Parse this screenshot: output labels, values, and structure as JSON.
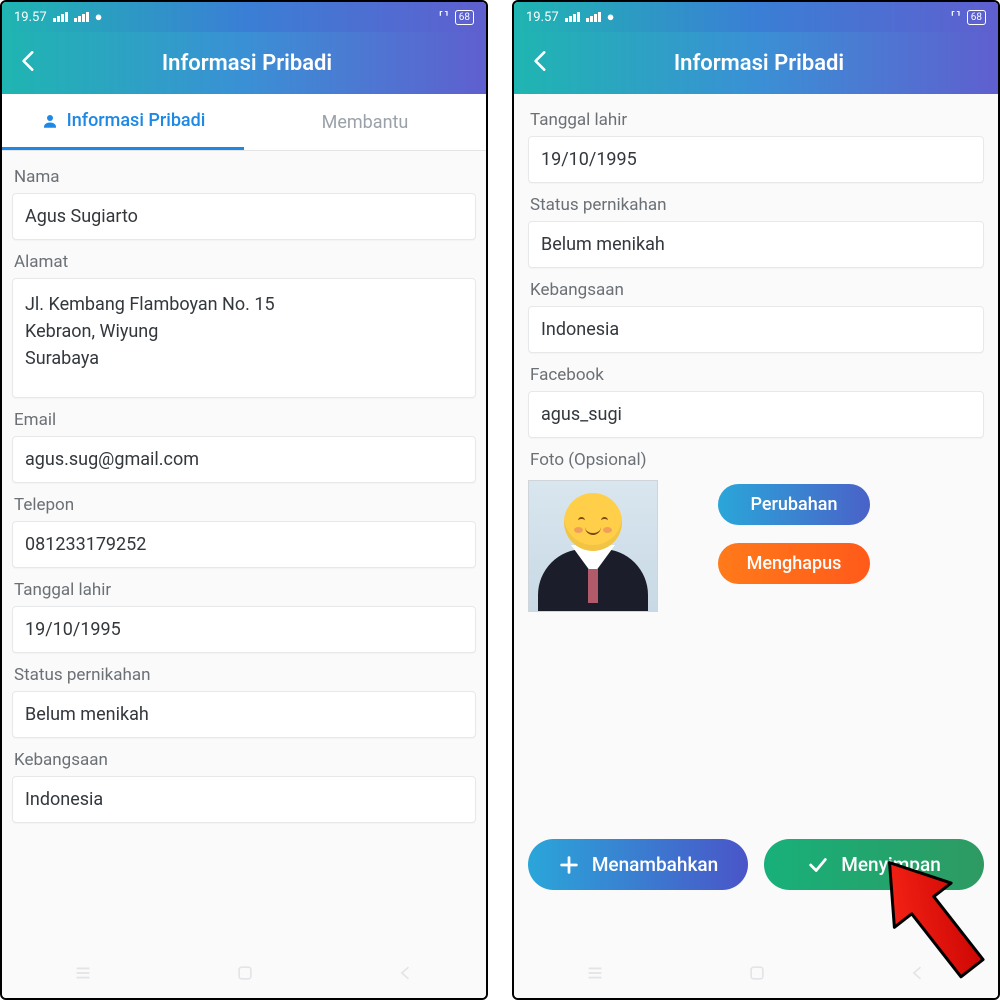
{
  "status": {
    "time": "19.57",
    "battery": "68"
  },
  "appbar": {
    "title": "Informasi Pribadi"
  },
  "tabs": {
    "personal": "Informasi Pribadi",
    "help": "Membantu"
  },
  "left": {
    "name_label": "Nama",
    "name": "Agus Sugiarto",
    "address_label": "Alamat",
    "address": "Jl. Kembang Flamboyan No. 15\nKebraon, Wiyung\nSurabaya",
    "email_label": "Email",
    "email": "agus.sug@gmail.com",
    "phone_label": "Telepon",
    "phone": "081233179252",
    "dob_label": "Tanggal lahir",
    "dob": "19/10/1995",
    "marital_label": "Status pernikahan",
    "marital": "Belum menikah",
    "nation_label": "Kebangsaan",
    "nation": "Indonesia"
  },
  "right": {
    "dob_label": "Tanggal lahir",
    "dob": "19/10/1995",
    "marital_label": "Status pernikahan",
    "marital": "Belum menikah",
    "nation_label": "Kebangsaan",
    "nation": "Indonesia",
    "fb_label": "Facebook",
    "fb": "agus_sugi",
    "photo_label": "Foto (Opsional)",
    "change_btn": "Perubahan",
    "delete_btn": "Menghapus",
    "add_btn": "Menambahkan",
    "save_btn": "Menyimpan"
  }
}
